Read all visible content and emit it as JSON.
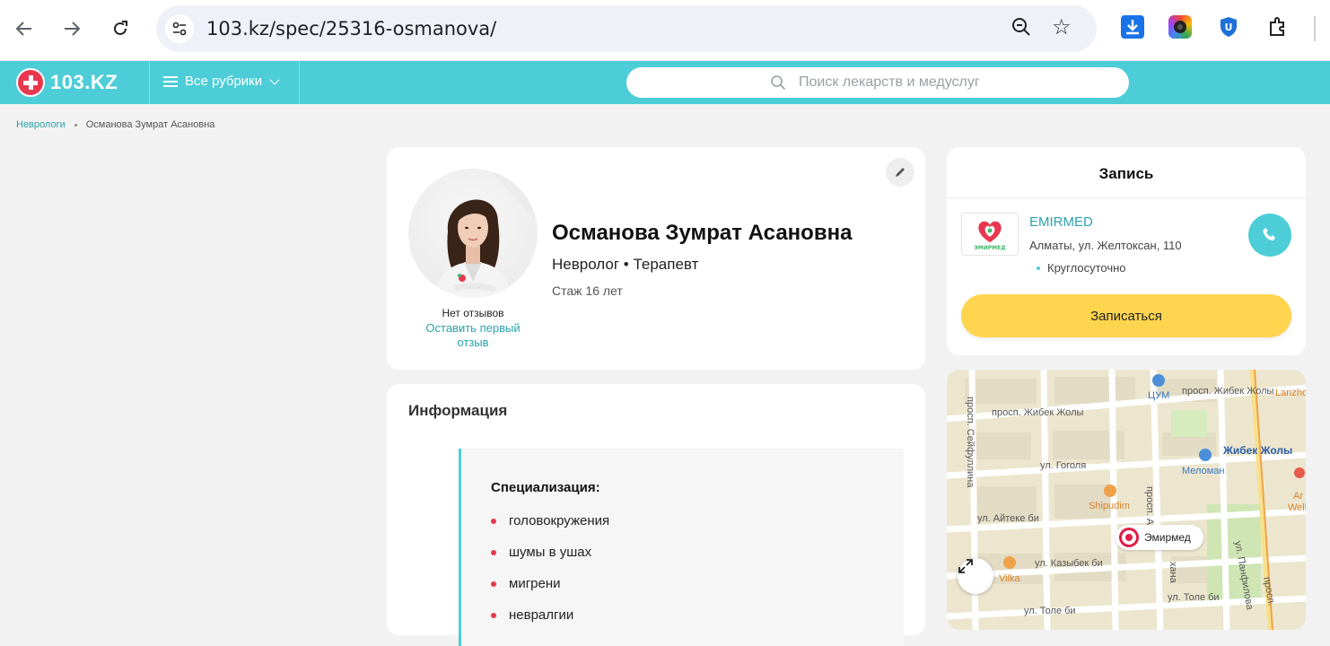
{
  "browser": {
    "url": "103.kz/spec/25316-osmanova/"
  },
  "site": {
    "logo_text": "103.KZ",
    "rubrics_label": "Все рубрики",
    "search_placeholder": "Поиск лекарств и медуслуг"
  },
  "breadcrumb": {
    "items": [
      "Неврологи",
      "Османова Зумрат Асановна"
    ]
  },
  "profile": {
    "name": "Османова Зумрат Асановна",
    "specialties": "Невролог • Терапевт",
    "experience": "Стаж 16 лет",
    "no_reviews": "Нет отзывов",
    "leave_review": "Оставить первый отзыв"
  },
  "info": {
    "title": "Информация",
    "section_title": "Специализация:",
    "items": [
      "головокружения",
      "шумы в ушах",
      "мигрени",
      "невралгии"
    ]
  },
  "booking": {
    "title": "Запись",
    "clinic_name": "EMIRMED",
    "clinic_address": "Алматы, ул. Желтоксан, 110",
    "clinic_hours": "Круглосуточно",
    "book_label": "Записаться",
    "logo_text": "ЭМИРМЕД"
  },
  "map": {
    "streets": {
      "s1": "просп. Жибек Жолы",
      "s2": "просп. Жибек Жолы",
      "s3": "ул. Гоголя",
      "s4": "ул. Айтеке би",
      "s5": "ул. Казыбек би",
      "s6": "ул. Толе би",
      "s7": "ул. Толе би",
      "s8": "просп. Сейфуллина",
      "s9": "просп. А",
      "s10": "хана",
      "s11": "ул. Панфилова",
      "s12": "просп."
    },
    "pois": {
      "p1": "ЦУМ",
      "p2": "Lanzho",
      "p3": "Жибек Жолы",
      "p4": "Меломан",
      "p5": "Shipudim",
      "p6": "Vilka",
      "p7": "Ar",
      "p8": "Wellne"
    },
    "marker_label": "Эмирмед"
  },
  "colors": {
    "brand": "#4dcdd7",
    "accent_red": "#e8384f",
    "button_yellow": "#ffd54f",
    "link": "#2ba3ad"
  }
}
